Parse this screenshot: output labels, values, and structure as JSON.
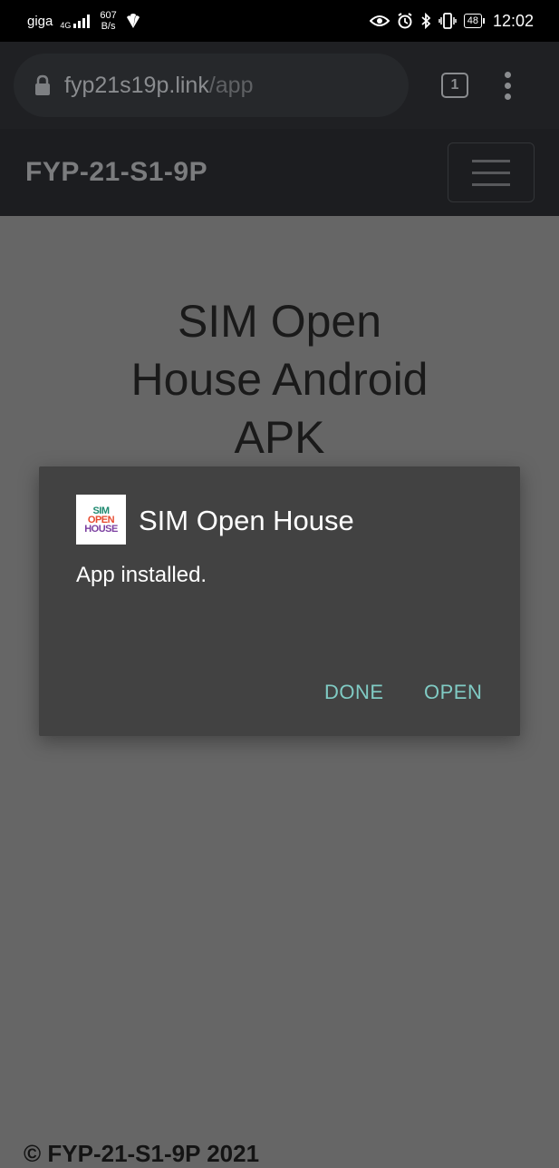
{
  "status_bar": {
    "carrier": "giga",
    "network_type": "4G",
    "net_speed_value": "607",
    "net_speed_unit": "B/s",
    "battery": "48",
    "time": "12:02"
  },
  "browser": {
    "url_host": "fyp21s19p.link",
    "url_path": "/app",
    "tab_count": "1"
  },
  "site_nav": {
    "brand": "FYP-21-S1-9P"
  },
  "page": {
    "heading_lines": [
      "SIM Open",
      "House Android",
      "APK"
    ],
    "footer": "© FYP-21-S1-9P 2021"
  },
  "dialog": {
    "app_name": "SIM Open House",
    "message": "App installed.",
    "done_label": "DONE",
    "open_label": "OPEN",
    "logo_lines": [
      "SIM",
      "OPEN",
      "HOUSE"
    ]
  },
  "colors": {
    "dialog_bg": "#424242",
    "button_text": "#80cbc4",
    "scrim": "#666666"
  }
}
